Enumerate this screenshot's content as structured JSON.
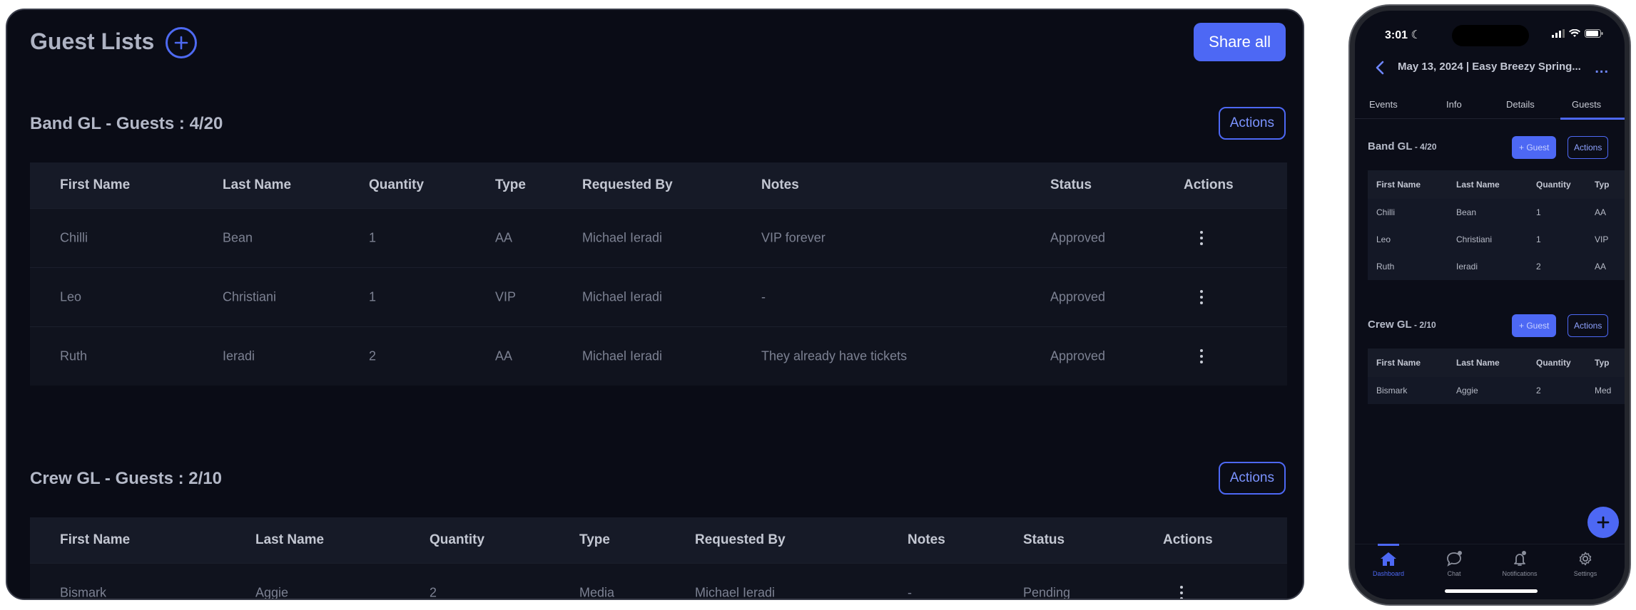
{
  "desktop": {
    "title": "Guest Lists",
    "share_all_label": "Share all",
    "sections": [
      {
        "title": "Band GL - Guests : 4/20",
        "actions_label": "Actions",
        "columns": [
          "First Name",
          "Last Name",
          "Quantity",
          "Type",
          "Requested By",
          "Notes",
          "Status",
          "Actions"
        ],
        "rows": [
          [
            "Chilli",
            "Bean",
            "1",
            "AA",
            "Michael Ieradi",
            "VIP forever",
            "Approved"
          ],
          [
            "Leo",
            "Christiani",
            "1",
            "VIP",
            "Michael Ieradi",
            "-",
            "Approved"
          ],
          [
            "Ruth",
            "Ieradi",
            "2",
            "AA",
            "Michael Ieradi",
            "They already have tickets",
            "Approved"
          ]
        ]
      },
      {
        "title": "Crew GL - Guests : 2/10",
        "actions_label": "Actions",
        "columns": [
          "First Name",
          "Last Name",
          "Quantity",
          "Type",
          "Requested By",
          "Notes",
          "Status",
          "Actions"
        ],
        "rows": [
          [
            "Bismark",
            "Aggie",
            "2",
            "Media",
            "Michael Ieradi",
            "-",
            "Pending"
          ]
        ]
      }
    ]
  },
  "phone": {
    "time": "3:01",
    "header": "May 13, 2024 | Easy Breezy Spring...",
    "more": "...",
    "tabs": [
      "Events",
      "Info",
      "Details",
      "Guests"
    ],
    "active_tab": "Guests",
    "sections": [
      {
        "title": "Band GL",
        "count": " - 4/20",
        "guest_label": "+ Guest",
        "actions_label": "Actions",
        "columns": [
          "First Name",
          "Last Name",
          "Quantity",
          "Typ"
        ],
        "rows": [
          [
            "Chilli",
            "Bean",
            "1",
            "AA"
          ],
          [
            "Leo",
            "Christiani",
            "1",
            "VIP"
          ],
          [
            "Ruth",
            "Ieradi",
            "2",
            "AA"
          ]
        ]
      },
      {
        "title": "Crew GL",
        "count": " - 2/10",
        "guest_label": "+ Guest",
        "actions_label": "Actions",
        "columns": [
          "First Name",
          "Last Name",
          "Quantity",
          "Typ"
        ],
        "rows": [
          [
            "Bismark",
            "Aggie",
            "2",
            "Med"
          ]
        ]
      }
    ],
    "nav": [
      "Dashboard",
      "Chat",
      "Notifications",
      "Settings"
    ],
    "active_nav": "Dashboard"
  },
  "colors": {
    "accent": "#4d68f4",
    "background": "#0a0c16"
  }
}
